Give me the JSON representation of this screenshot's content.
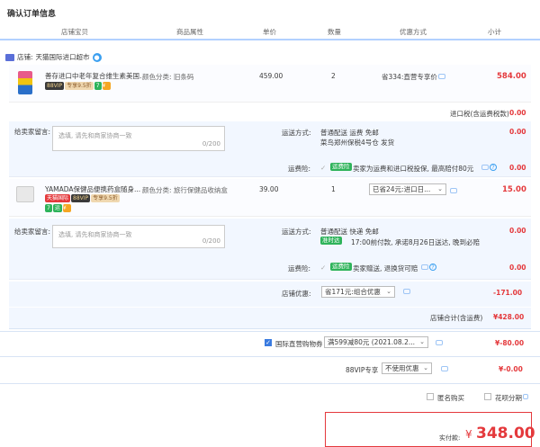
{
  "page": {
    "title": "确认订单信息"
  },
  "headers": {
    "store_item": "店铺宝贝",
    "attr": "商品属性",
    "price": "单价",
    "qty": "数量",
    "discount": "优惠方式",
    "subtotal": "小计"
  },
  "store": {
    "label": "店铺:",
    "name": "天猫国际进口超市"
  },
  "item1": {
    "name": "善存进口中老年复合维生素美国...",
    "attr": "颜色分类: 旧条码",
    "price": "459.00",
    "qty": "2",
    "discount": "省334:直营专享价",
    "subtotal": "584.00",
    "tags": [
      "88VIP",
      "专享9.5折",
      "7",
      "¥"
    ]
  },
  "tax": {
    "label": "进口税(含运费税款)",
    "value": "0.00"
  },
  "msg1": {
    "label": "给卖家留言:",
    "placeholder": "选填, 请先和商家协商一致",
    "counter": "0/200"
  },
  "ship1": {
    "label": "运送方式:",
    "method": "普通配送 运费 免邮",
    "warehouse": "菜鸟郑州保税4号仓  发货",
    "value": "0.00"
  },
  "ins1": {
    "label": "运费险:",
    "badge": "运费险",
    "text": "卖家为运费和进口税投保, 最高赔付80元",
    "value": "0.00"
  },
  "item2": {
    "name": "YAMADA保健品便携药盒随身...",
    "attr": "颜色分类: 旅行保健品收纳盒",
    "price": "39.00",
    "qty": "1",
    "discount": "已省24元:进口日...",
    "subtotal": "15.00",
    "tags": [
      "天猫国际",
      "88VIP",
      "专享9.5折",
      "7",
      "运",
      "¥"
    ]
  },
  "msg2": {
    "label": "给卖家留言:",
    "placeholder": "选填, 请先和商家协商一致",
    "counter": "0/200"
  },
  "ship2": {
    "label": "运送方式:",
    "method": "普通配送 快递 免邮",
    "badge": "准时达",
    "promise": "17:00前付款, 承诺8月26日送达, 晚到必赔",
    "value": "0.00"
  },
  "ins2": {
    "label": "运费险:",
    "badge": "运费险",
    "text": "卖家赠送, 退换货可赔",
    "value": "0.00"
  },
  "store_discount": {
    "label": "店铺优惠:",
    "option": "省171元:组合优惠",
    "value": "-171.00"
  },
  "store_total": {
    "label": "店铺合计(含运费)",
    "value": "¥428.00"
  },
  "coupon": {
    "label": "国际直营购物券",
    "option": "满599减80元 (2021.08.2...",
    "value": "¥-80.00"
  },
  "vip": {
    "label": "88VIP专享",
    "option": "不使用优惠",
    "value": "¥-0.00"
  },
  "anon": {
    "label": "匿名购买"
  },
  "huabei": {
    "label": "花呗分期"
  },
  "pay": {
    "label": "实付款:",
    "currency": "¥",
    "amount": "348.00"
  },
  "colors": {
    "accent": "#e4393c",
    "panel": "#f2f7ff",
    "header_line": "#b2d1ff"
  }
}
